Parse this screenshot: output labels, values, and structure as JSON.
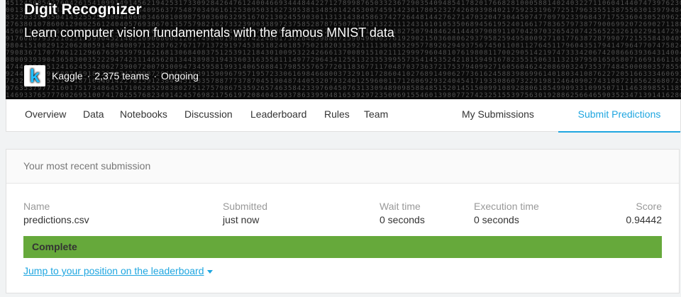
{
  "competition": {
    "title": "Digit Recognizer",
    "subtitle": "Learn computer vision fundamentals with the famous MNIST data",
    "logo_letter": "k",
    "host": "Kaggle",
    "sep1": "·",
    "teams": "2,375 teams",
    "sep2": "·",
    "status": "Ongoing"
  },
  "nav": {
    "tabs": [
      {
        "label": "Overview"
      },
      {
        "label": "Data"
      },
      {
        "label": "Notebooks"
      },
      {
        "label": "Discussion"
      },
      {
        "label": "Leaderboard"
      },
      {
        "label": "Rules"
      },
      {
        "label": "Team"
      }
    ],
    "my_submissions": "My Submissions",
    "submit_predictions": "Submit Predictions"
  },
  "submission": {
    "heading": "Your most recent submission",
    "columns": {
      "name_label": "Name",
      "name_value": "predictions.csv",
      "submitted_label": "Submitted",
      "submitted_value": "just now",
      "wait_label": "Wait time",
      "wait_value": "0 seconds",
      "exec_label": "Execution time",
      "exec_value": "0 seconds",
      "score_label": "Score",
      "score_value": "0.94442"
    },
    "status": "Complete",
    "jump_link": "Jump to your position on the leaderboard"
  },
  "colors": {
    "accent": "#1fa6e0",
    "complete_bar": "#66a93b",
    "banner_bg": "#0a0a0a"
  },
  "icons": {
    "logo": "kaggle-logo-icon",
    "caret": "caret-down-icon"
  }
}
